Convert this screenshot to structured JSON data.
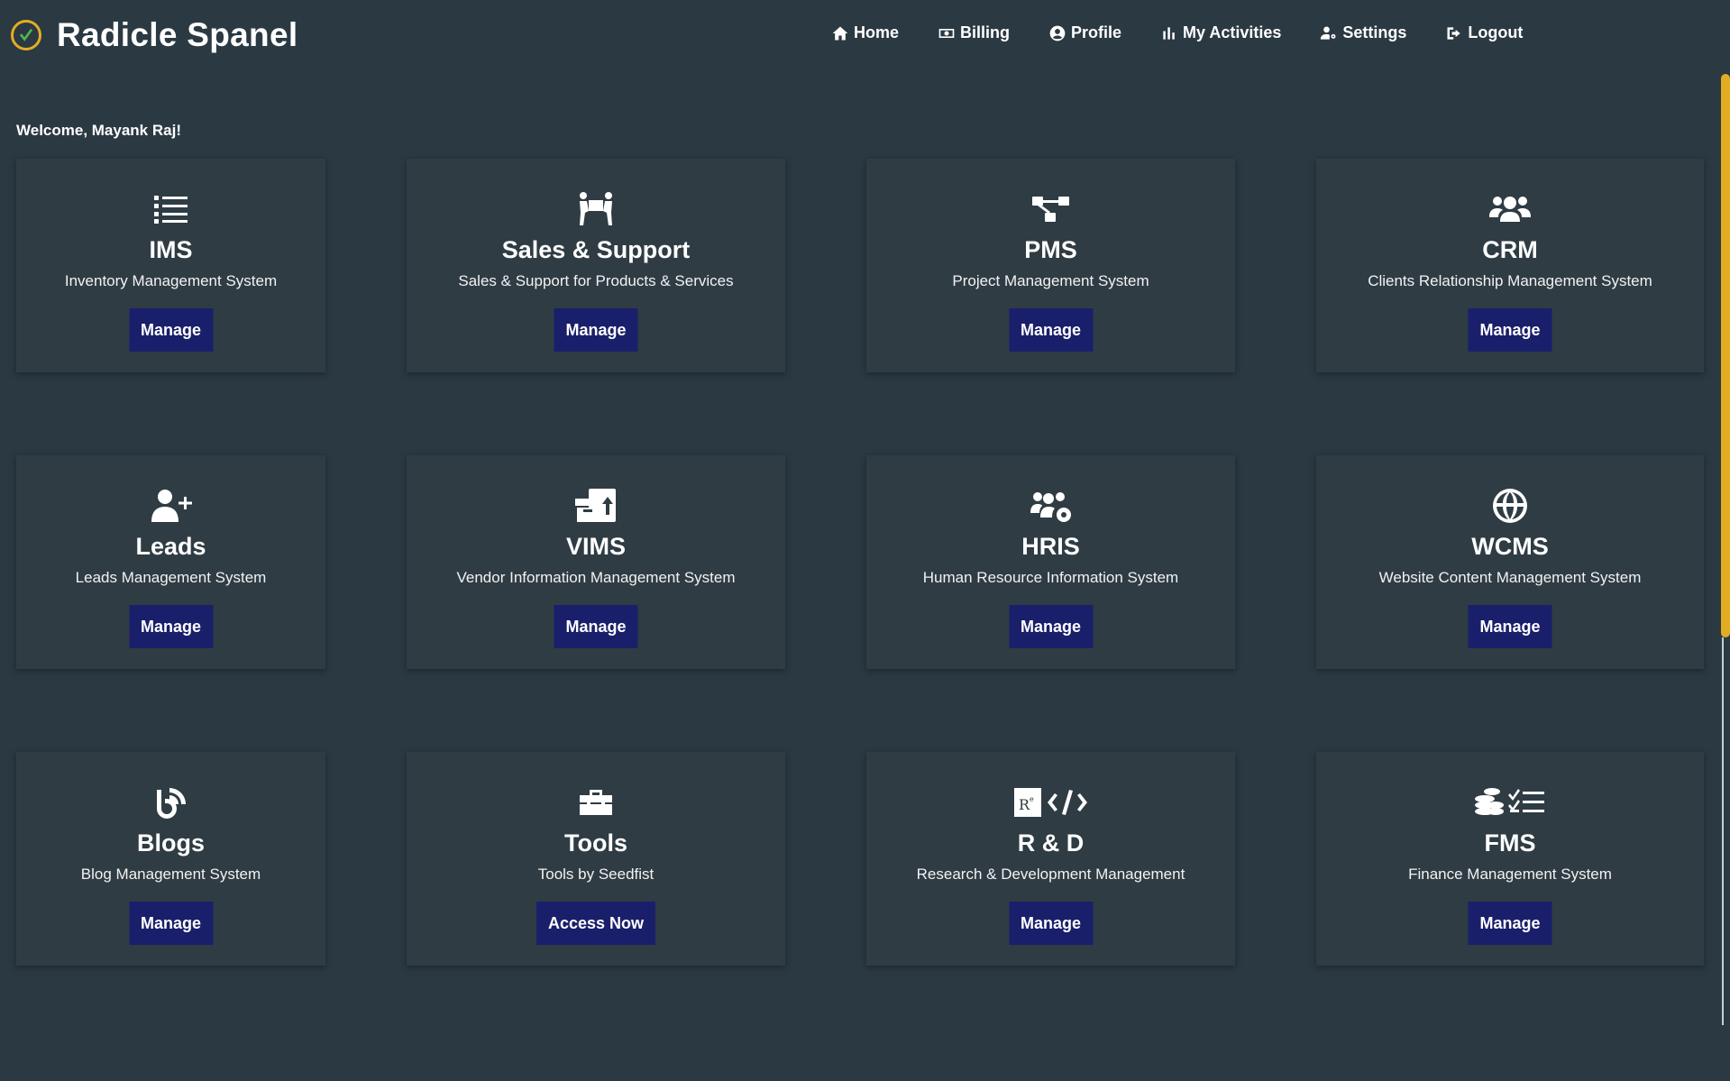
{
  "header": {
    "brand": "Radicle Spanel",
    "nav": [
      {
        "label": "Home",
        "icon": "home-icon"
      },
      {
        "label": "Billing",
        "icon": "money-bill-icon"
      },
      {
        "label": "Profile",
        "icon": "user-circle-icon"
      },
      {
        "label": "My Activities",
        "icon": "chart-bar-icon"
      },
      {
        "label": "Settings",
        "icon": "user-cog-icon"
      },
      {
        "label": "Logout",
        "icon": "sign-out-icon"
      }
    ]
  },
  "welcome": "Welcome, Mayank Raj!",
  "cards": [
    {
      "title": "IMS",
      "subtitle": "Inventory Management System",
      "button": "Manage",
      "icon": "list-icon"
    },
    {
      "title": "Sales & Support",
      "subtitle": "Sales & Support for Products & Services",
      "button": "Manage",
      "icon": "people-carry-icon"
    },
    {
      "title": "PMS",
      "subtitle": "Project Management System",
      "button": "Manage",
      "icon": "project-diagram-icon"
    },
    {
      "title": "CRM",
      "subtitle": "Clients Relationship Management System",
      "button": "Manage",
      "icon": "users-icon"
    },
    {
      "title": "Leads",
      "subtitle": "Leads Management System",
      "button": "Manage",
      "icon": "user-plus-icon"
    },
    {
      "title": "VIMS",
      "subtitle": "Vendor Information Management System",
      "button": "Manage",
      "icon": "box-upload-icon"
    },
    {
      "title": "HRIS",
      "subtitle": "Human Resource Information System",
      "button": "Manage",
      "icon": "users-cog-icon"
    },
    {
      "title": "WCMS",
      "subtitle": "Website Content Management System",
      "button": "Manage",
      "icon": "globe-icon"
    },
    {
      "title": "Blogs",
      "subtitle": "Blog Management System",
      "button": "Manage",
      "icon": "blog-icon"
    },
    {
      "title": "Tools",
      "subtitle": "Tools by Seedfist",
      "button": "Access Now",
      "icon": "toolbox-icon"
    },
    {
      "title": "R & D",
      "subtitle": "Research & Development Management",
      "button": "Manage",
      "icon": "research-code-icon"
    },
    {
      "title": "FMS",
      "subtitle": "Finance Management System",
      "button": "Manage",
      "icon": "coins-checklist-icon"
    }
  ],
  "colors": {
    "background": "#2b3942",
    "card": "#2f3c44",
    "button": "#1a1f6b",
    "accent": "#e2ad24"
  }
}
